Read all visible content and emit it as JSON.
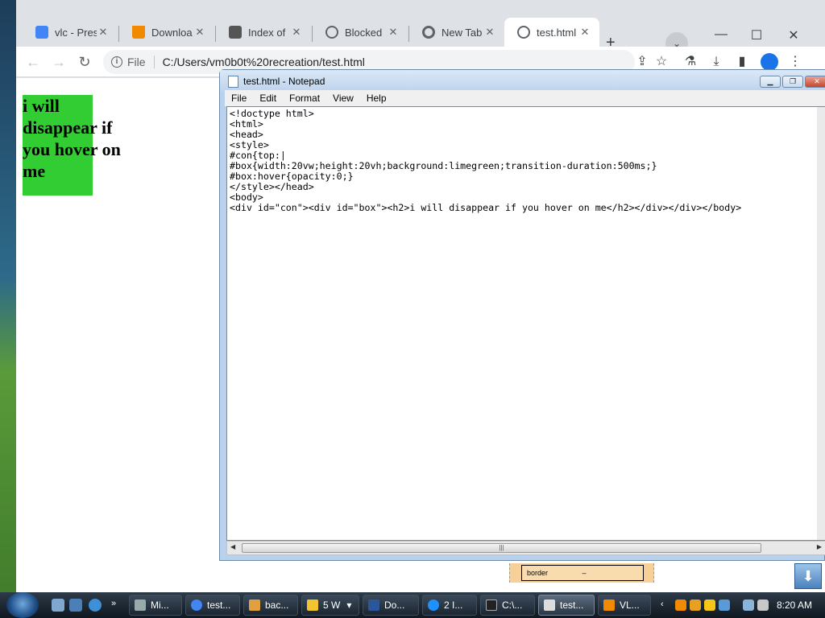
{
  "browser": {
    "tabs": [
      {
        "title": "vlc - Prese",
        "icon": "presentation-icon",
        "color": "#4285f4"
      },
      {
        "title": "Downloa",
        "icon": "vlc-cone-icon",
        "color": "#f08a00"
      },
      {
        "title": "Index of",
        "icon": "puzzle-icon",
        "color": "#555"
      },
      {
        "title": "Blocked",
        "icon": "globe-icon",
        "color": "#5f6368"
      },
      {
        "title": "New Tab",
        "icon": "chrome-icon",
        "color": "#5f6368"
      },
      {
        "title": "test.html",
        "icon": "globe-icon",
        "color": "#5f6368"
      }
    ],
    "address": {
      "scheme": "File",
      "url": "C:/Users/vm0b0t%20recreation/test.html"
    },
    "page": {
      "heading": "i will disappear if you hover on me",
      "box_color": "#32cd32"
    }
  },
  "notepad": {
    "title": "test.html - Notepad",
    "menu": [
      "File",
      "Edit",
      "Format",
      "View",
      "Help"
    ],
    "content": "<!doctype html>\n<html>\n<head>\n<style>\n#con{top:|\n#box{width:20vw;height:20vh;background:limegreen;transition-duration:500ms;}\n#box:hover{opacity:0;}\n</style></head>\n<body>\n<div id=\"con\"><div id=\"box\"><h2>i will disappear if you hover on me</h2></div></div></body>"
  },
  "devtools_fragment": {
    "label": "border",
    "value": "–"
  },
  "taskbar": {
    "items": [
      {
        "label": "Mi...",
        "color": "#9aa"
      },
      {
        "label": "test...",
        "color": "#4285f4"
      },
      {
        "label": "bac...",
        "color": "#e0a040"
      },
      {
        "label": "5 W",
        "color": "#f4c430"
      },
      {
        "label": "Do...",
        "color": "#2b579a"
      },
      {
        "label": "2 I...",
        "color": "#1e90ff"
      },
      {
        "label": "C:\\...",
        "color": "#222"
      },
      {
        "label": "test...",
        "color": "#ddd"
      },
      {
        "label": "VL...",
        "color": "#f08a00"
      }
    ],
    "clock": "8:20 AM"
  }
}
